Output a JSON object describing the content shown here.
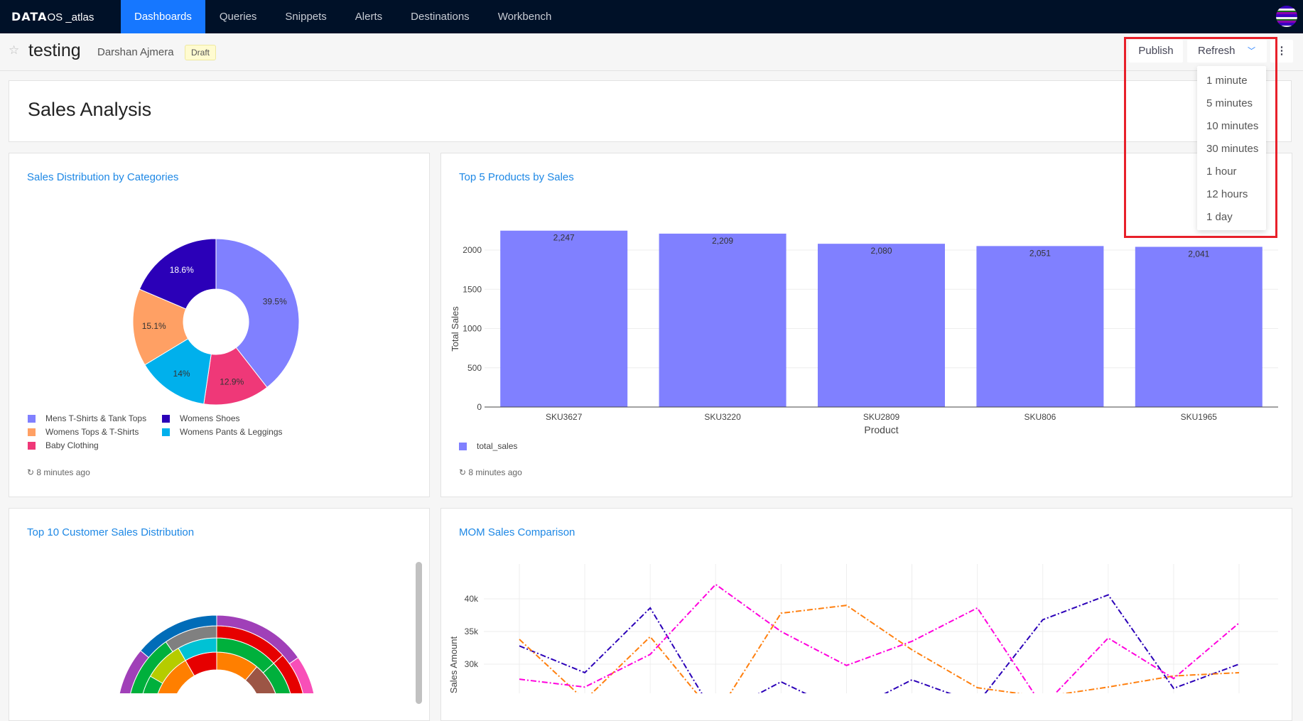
{
  "nav": {
    "logo_brand": "DATA",
    "logo_suffix": "OS _atlas",
    "items": [
      "Dashboards",
      "Queries",
      "Snippets",
      "Alerts",
      "Destinations",
      "Workbench"
    ],
    "active": "Dashboards"
  },
  "header": {
    "title": "testing",
    "owner": "Darshan Ajmera",
    "status_badge": "Draft",
    "publish_label": "Publish",
    "refresh_label": "Refresh",
    "refresh_options": [
      "1 minute",
      "5 minutes",
      "10 minutes",
      "30 minutes",
      "1 hour",
      "12 hours",
      "1 day"
    ]
  },
  "text_widget": {
    "title": "Sales Analysis"
  },
  "widgets": {
    "pie": {
      "title": "Sales Distribution by Categories",
      "updated": "8 minutes ago"
    },
    "bar": {
      "title": "Top 5 Products by Sales",
      "updated": "8 minutes ago"
    },
    "sunburst": {
      "title": "Top 10 Customer Sales Distribution"
    },
    "line": {
      "title": "MOM Sales Comparison"
    }
  },
  "colors": {
    "accent": "#1677ff",
    "nav_bg": "#001128",
    "title_link": "#1e88e5",
    "highlight_box": "#e8202a"
  },
  "chart_data": [
    {
      "type": "pie",
      "hole": true,
      "labels": [
        "Mens T-Shirts & Tank Tops",
        "Baby Clothing",
        "Womens Pants & Leggings",
        "Womens Tops & T-Shirts",
        "Womens Shoes"
      ],
      "values": [
        39.5,
        12.9,
        14,
        15.1,
        18.6
      ],
      "value_labels": [
        "39.5%",
        "12.9%",
        "14%",
        "15.1%",
        "18.6%"
      ],
      "colors": [
        "#8080ff",
        "#ef3878",
        "#00b0ec",
        "#ffa064",
        "#2b00b8"
      ],
      "legend": [
        {
          "label": "Mens T-Shirts & Tank Tops",
          "color": "#8080ff"
        },
        {
          "label": "Womens Shoes",
          "color": "#2b00b8"
        },
        {
          "label": "Womens Tops & T-Shirts",
          "color": "#ffa064"
        },
        {
          "label": "Womens Pants & Leggings",
          "color": "#00b0ec"
        },
        {
          "label": "Baby Clothing",
          "color": "#ef3878"
        }
      ],
      "legend_placement": "bottom"
    },
    {
      "type": "bar",
      "categories": [
        "SKU3627",
        "SKU3220",
        "SKU2809",
        "SKU806",
        "SKU1965"
      ],
      "values": [
        2247,
        2209,
        2080,
        2051,
        2041
      ],
      "value_labels": [
        "2,247",
        "2,209",
        "2,080",
        "2,051",
        "2,041"
      ],
      "xlabel": "Product",
      "ylabel": "Total Sales",
      "yticks": [
        "0",
        "500",
        "1000",
        "1500",
        "2000"
      ],
      "ylim": [
        0,
        2400
      ],
      "series_name": "total_sales",
      "color": "#8080ff",
      "grid": true,
      "legend_placement": "bottom-left"
    },
    {
      "type": "line",
      "ylabel": "Sales Amount",
      "yticks": [
        "30k",
        "35k",
        "40k"
      ],
      "ylim": [
        20000,
        43500
      ],
      "grid": true,
      "series": [
        {
          "color": "#2b00b8",
          "values": [
            32800,
            28700,
            38600,
            22000,
            27300,
            22500,
            27600,
            24000,
            36800,
            40600,
            26300,
            30000
          ]
        },
        {
          "color": "#ff7f0e",
          "values": [
            33800,
            24500,
            34200,
            22000,
            37800,
            39000,
            32200,
            26400,
            25000,
            26500,
            28200,
            28700
          ]
        },
        {
          "color": "#ff00dd",
          "values": [
            27700,
            26500,
            31500,
            42200,
            35000,
            29800,
            33500,
            38600,
            23500,
            34000,
            27800,
            36300
          ]
        }
      ]
    }
  ]
}
